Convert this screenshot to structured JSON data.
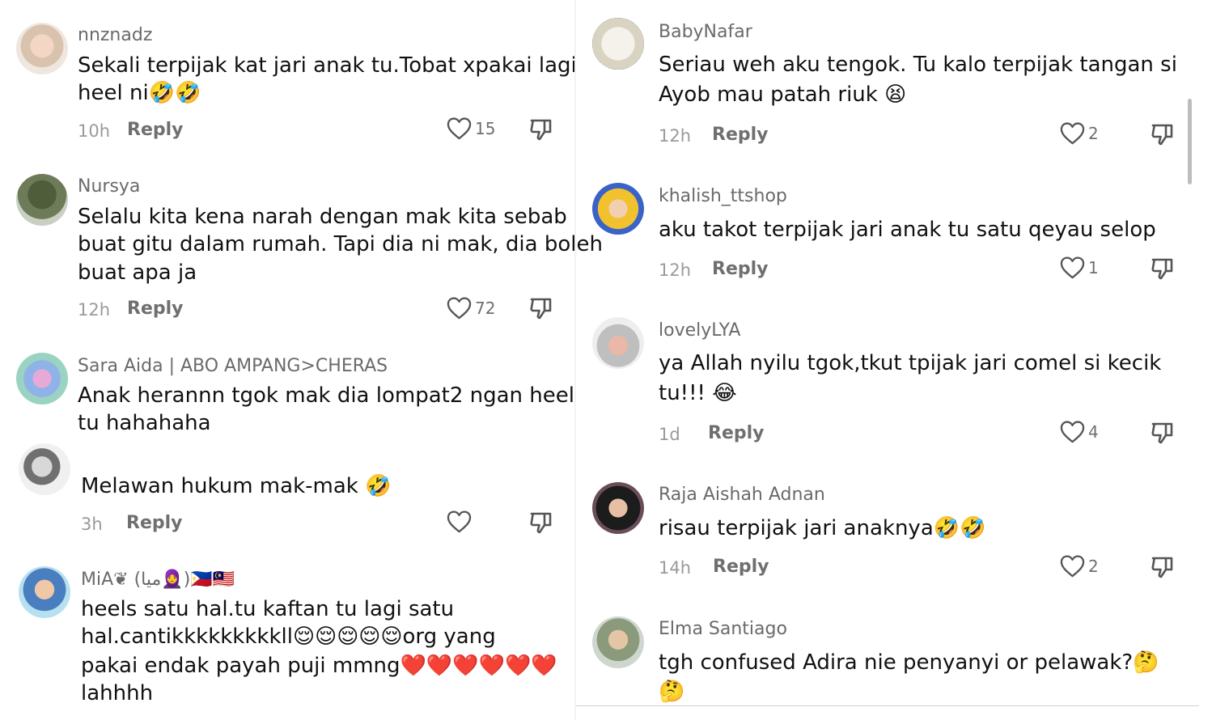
{
  "left_comments": [
    {
      "username": "nnznadz",
      "lines": [
        "Sekali terpijak kat jari anak tu.Tobat xpakai lagi",
        "heel ni🤣🤣"
      ],
      "time": "10h",
      "reply": "Reply",
      "likes": "15"
    },
    {
      "username": "Nursya",
      "lines": [
        "Selalu kita kena narah dengan mak kita sebab",
        "buat gitu dalam rumah. Tapi dia ni mak, dia boleh",
        "buat apa ja"
      ],
      "time": "12h",
      "reply": "Reply",
      "likes": "72"
    },
    {
      "username": "Sara Aida | ABO AMPANG>CHERAS",
      "lines": [
        "Anak herannn tgok mak dia lompat2 ngan heel",
        "tu hahahaha"
      ]
    },
    {
      "username": "",
      "lines": [
        "Melawan hukum mak-mak 🤣"
      ],
      "time": "3h",
      "reply": "Reply",
      "likes": ""
    },
    {
      "username": "MiA❦ (ميا🧕)🇵🇭🇲🇾",
      "lines": [
        "heels satu hal.tu kaftan tu lagi satu",
        "hal.cantikkkkkkkkkll😌😌😌😌😌org yang",
        "pakai endak payah puji mmng❤️❤️❤️❤️❤️❤️",
        "lahhhh"
      ]
    }
  ],
  "right_comments": [
    {
      "username": "BabyNafar",
      "lines": [
        "Seriau weh aku tengok. Tu kalo terpijak tangan si",
        "Ayob mau patah riuk 😫"
      ],
      "time": "12h",
      "reply": "Reply",
      "likes": "2"
    },
    {
      "username": "khalish_ttshop",
      "lines": [
        "aku takot terpijak jari anak tu satu qeyau selop"
      ],
      "time": "12h",
      "reply": "Reply",
      "likes": "1"
    },
    {
      "username": "lovelyLYA",
      "lines": [
        "ya Allah nyilu tgok,tkut tpijak jari comel si kecik",
        "tu!!! 😂"
      ],
      "time": "1d",
      "reply": "Reply",
      "likes": "4"
    },
    {
      "username": "Raja Aishah Adnan",
      "lines": [
        "risau terpijak jari anaknya🤣🤣"
      ],
      "time": "14h",
      "reply": "Reply",
      "likes": "2"
    },
    {
      "username": "Elma Santiago",
      "lines": [
        "tgh confused Adira nie penyanyi or pelawak?🤔",
        "🤔"
      ]
    }
  ],
  "icons": {
    "like": "heart-outline-icon",
    "dislike": "thumbs-down-icon"
  },
  "colors": {
    "text": "#111111",
    "username": "#6a6a6a",
    "meta": "#9a9a9a"
  }
}
